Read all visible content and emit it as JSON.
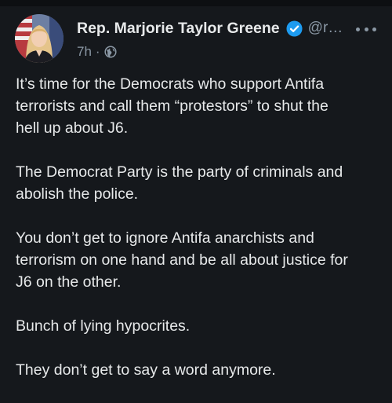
{
  "author": {
    "display_name": "Rep. Marjorie Taylor Greene",
    "handle": "@r…"
  },
  "meta": {
    "time": "7h",
    "separator": "·"
  },
  "icons": {
    "verified": "verified-badge-icon",
    "audience": "globe-icon",
    "menu": "more-options-icon"
  },
  "colors": {
    "background": "#15181c",
    "text": "#e7e9ea",
    "secondary_text": "#8b98a5",
    "verified_blue": "#1d9bf0"
  },
  "post": {
    "paragraphs": [
      {
        "lines": [
          "It’s time for the Democrats who support Antifa",
          "terrorists and call them “protestors” to shut the",
          "hell up about J6."
        ]
      },
      {
        "lines": [
          "The Democrat Party is the party of criminals and",
          "abolish the police."
        ]
      },
      {
        "lines": [
          "You don’t get to ignore Antifa anarchists and",
          "terrorism on one hand and be all about justice for",
          "J6 on the other."
        ]
      },
      {
        "lines": [
          "Bunch of lying hypocrites."
        ]
      },
      {
        "lines": [
          "They don’t get to say a word anymore."
        ]
      }
    ]
  }
}
